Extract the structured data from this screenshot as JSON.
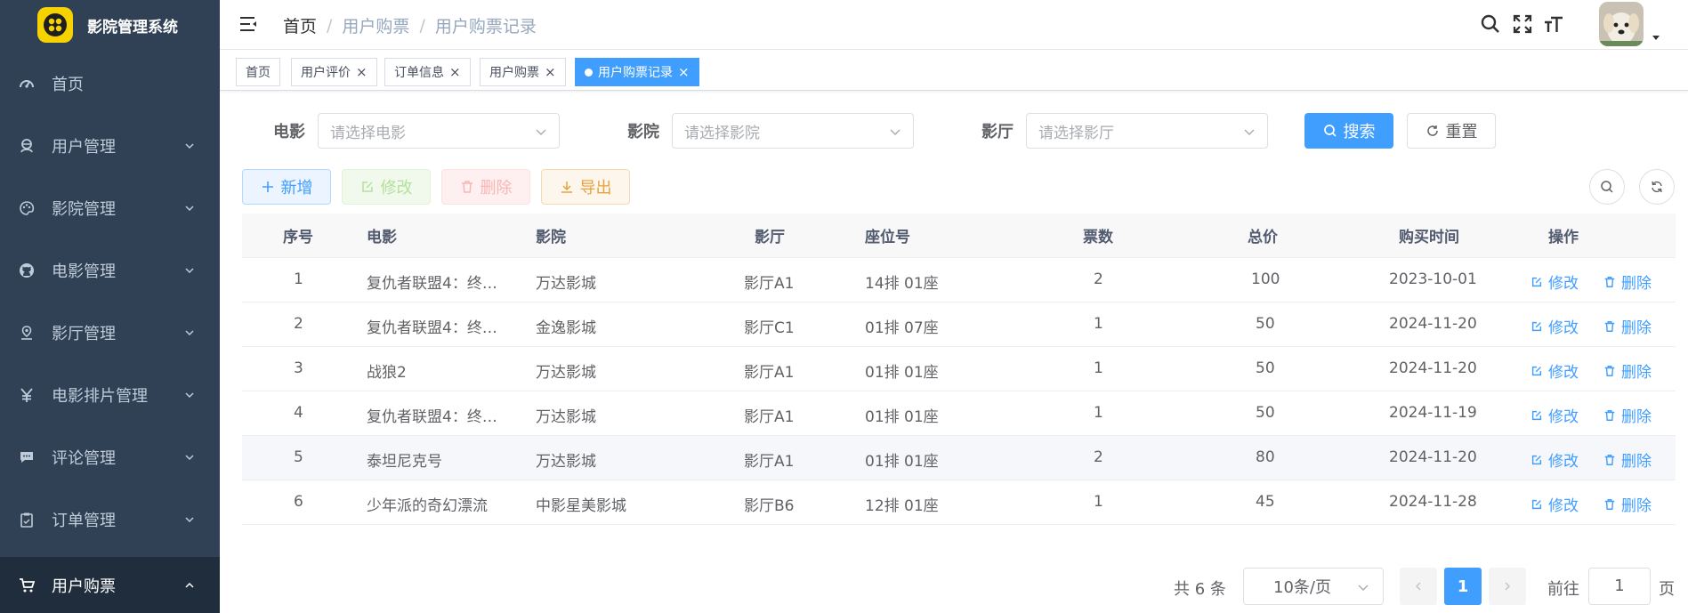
{
  "app": {
    "title": "影院管理系统"
  },
  "sidebar": {
    "items": [
      {
        "label": "首页",
        "icon": "dashboard-icon"
      },
      {
        "label": "用户管理",
        "icon": "user-icon"
      },
      {
        "label": "影院管理",
        "icon": "palette-icon"
      },
      {
        "label": "电影管理",
        "icon": "github-icon"
      },
      {
        "label": "影厅管理",
        "icon": "location-icon"
      },
      {
        "label": "电影排片管理",
        "icon": "yen-icon"
      },
      {
        "label": "评论管理",
        "icon": "message-icon"
      },
      {
        "label": "订单管理",
        "icon": "clipboard-icon"
      },
      {
        "label": "用户购票",
        "icon": "cart-icon"
      }
    ]
  },
  "breadcrumb": {
    "home": "首页",
    "parent": "用户购票",
    "current": "用户购票记录"
  },
  "tags": [
    {
      "label": "首页"
    },
    {
      "label": "用户评价"
    },
    {
      "label": "订单信息"
    },
    {
      "label": "用户购票"
    },
    {
      "label": "用户购票记录"
    }
  ],
  "search": {
    "movie_label": "电影",
    "movie_placeholder": "请选择电影",
    "cinema_label": "影院",
    "cinema_placeholder": "请选择影院",
    "hall_label": "影厅",
    "hall_placeholder": "请选择影厅",
    "search_button": "搜索",
    "reset_button": "重置"
  },
  "toolbar": {
    "add": "新增",
    "edit": "修改",
    "delete": "删除",
    "export": "导出"
  },
  "table": {
    "columns": [
      "序号",
      "电影",
      "影院",
      "影厅",
      "座位号",
      "票数",
      "总价",
      "购买时间",
      "操作"
    ],
    "rows": [
      {
        "index": "1",
        "movie": "复仇者联盟4：终…",
        "cinema": "万达影城",
        "hall": "影厅A1",
        "seat": "14排 01座",
        "count": "2",
        "price": "100",
        "time": "2023-10-01"
      },
      {
        "index": "2",
        "movie": "复仇者联盟4：终…",
        "cinema": "金逸影城",
        "hall": "影厅C1",
        "seat": "01排 07座",
        "count": "1",
        "price": "50",
        "time": "2024-11-20"
      },
      {
        "index": "3",
        "movie": "战狼2",
        "cinema": "万达影城",
        "hall": "影厅A1",
        "seat": "01排 01座",
        "count": "1",
        "price": "50",
        "time": "2024-11-20"
      },
      {
        "index": "4",
        "movie": "复仇者联盟4：终…",
        "cinema": "万达影城",
        "hall": "影厅A1",
        "seat": "01排 01座",
        "count": "1",
        "price": "50",
        "time": "2024-11-19"
      },
      {
        "index": "5",
        "movie": "泰坦尼克号",
        "cinema": "万达影城",
        "hall": "影厅A1",
        "seat": "01排 01座",
        "count": "2",
        "price": "80",
        "time": "2024-11-20"
      },
      {
        "index": "6",
        "movie": "少年派的奇幻漂流",
        "cinema": "中影星美影城",
        "hall": "影厅B6",
        "seat": "12排 01座",
        "count": "1",
        "price": "45",
        "time": "2024-11-28"
      }
    ],
    "row_edit": "修改",
    "row_delete": "删除"
  },
  "pagination": {
    "total": "共 6 条",
    "page_size": "10条/页",
    "current_page": "1",
    "goto_label": "前往",
    "goto_value": "1",
    "page_suffix": "页"
  },
  "colors": {
    "primary": "#409eff",
    "sidebar_bg": "#304156",
    "active_menu_bg": "#1f2d3d"
  }
}
